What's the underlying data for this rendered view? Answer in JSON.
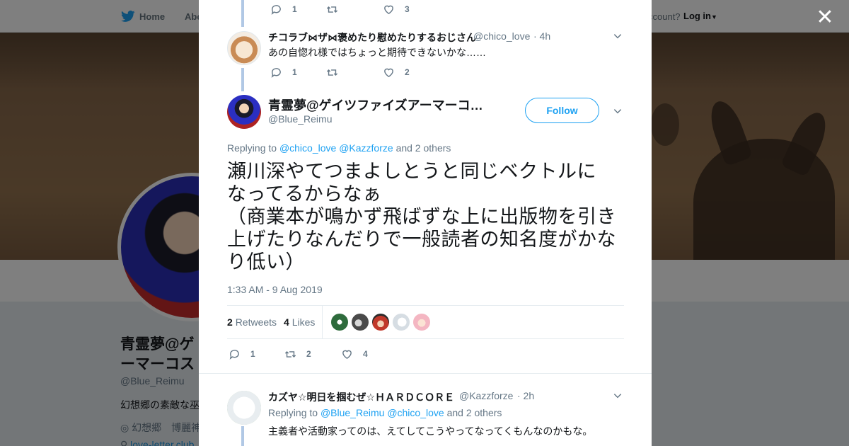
{
  "nav": {
    "home": "Home",
    "about": "Abo",
    "account_prompt": "ccount?",
    "login": "Log in"
  },
  "profile": {
    "name": "青霊夢@ゲイツファイズアーマーコスプレ",
    "name_line1": "青霊夢@ゲ",
    "name_line2": "ーマーコス",
    "handle": "@Blue_Reimu",
    "bio": "幻想郷の素敵な巫",
    "location": "幻想郷　博麗神",
    "link": "love-letter.club"
  },
  "modal": {
    "prev_tweet_actions": {
      "replies": "1",
      "retweets": "",
      "likes": "3"
    },
    "tweet1": {
      "name": "チコラブ⋈ザ⋈褒めたり慰めたりするおじさん",
      "handle": "@chico_love",
      "time": "· 4h",
      "text": "あの自惚れ様ではちょっと期待できないかな……",
      "replies": "1",
      "retweets": "",
      "likes": "2"
    },
    "main": {
      "name": "青霊夢@ゲイツファイズアーマーコ…",
      "handle": "@Blue_Reimu",
      "follow_label": "Follow",
      "replying_prefix": "Replying to",
      "replying_to_1": "@chico_love",
      "replying_to_2": "@Kazzforze",
      "replying_suffix": "and 2 others",
      "text_lines": [
        "瀬川深やてつまよしとうと同じベクトルに",
        "なってるからなぁ",
        "（商業本が鳴かず飛ばずな上に出版物を引き",
        "上げたりなんだりで一般読者の知名度がかな",
        "り低い）"
      ],
      "timestamp": "1:33 AM - 9 Aug 2019",
      "retweet_count": "2",
      "retweet_label": "Retweets",
      "like_count": "4",
      "like_label": "Likes",
      "action_replies": "1",
      "action_retweets": "2",
      "action_likes": "4"
    },
    "tweet3": {
      "name": "カズヤ☆明日を掴むぜ☆ＨＡＲＤＣＯＲＥ",
      "handle": "@Kazzforze",
      "time": "· 2h",
      "replying_prefix": "Replying to",
      "replying_to_1": "@Blue_Reimu",
      "replying_to_2": "@chico_love",
      "replying_suffix": "and 2 others",
      "text": "主義者や活動家ってのは、えてしてこうやってなってくもんなのかもな。"
    },
    "close_icon": "close-icon"
  },
  "colors": {
    "accent": "#1da1f2",
    "thread_line": "#b1c8e5",
    "like_avatars": [
      "#2e6b3c",
      "#4a4a4a",
      "#c0392b",
      "#d6dde3",
      "#f4b6c2"
    ]
  }
}
